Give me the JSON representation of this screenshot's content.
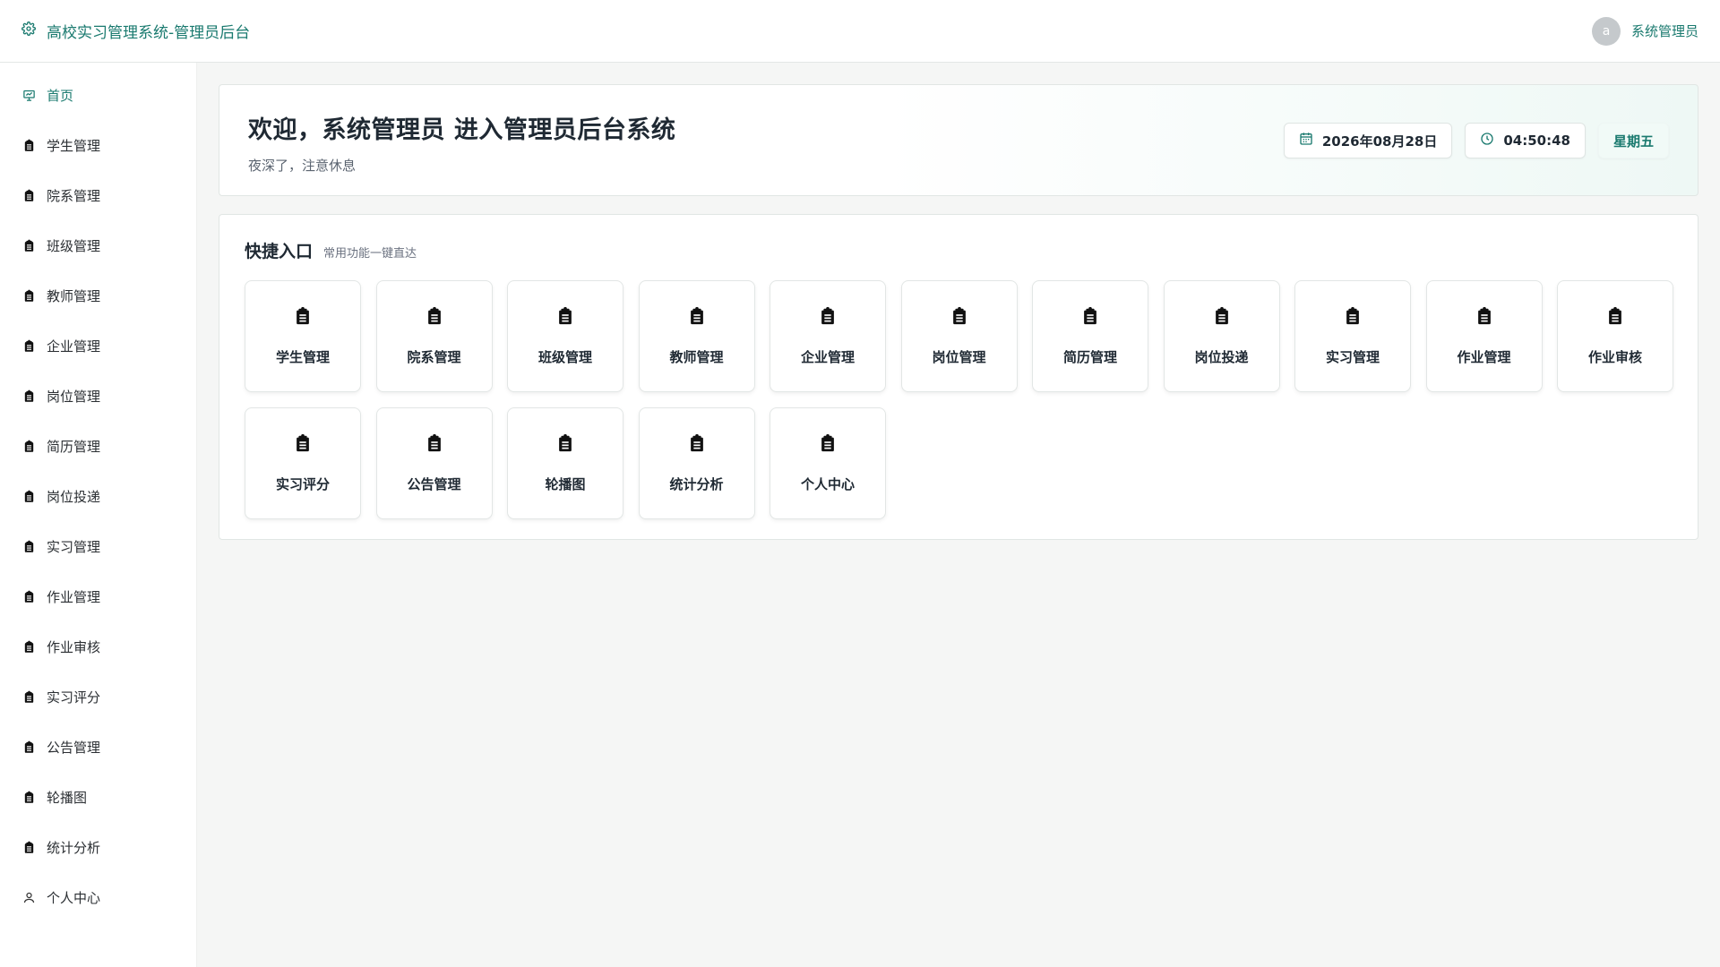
{
  "header": {
    "title": "高校实习管理系统-管理员后台",
    "user_initial": "a",
    "user_name": "系统管理员",
    "accent": "#1a7a6f"
  },
  "sidebar": {
    "items": [
      {
        "label": "首页",
        "icon": "presentation-icon",
        "active": true
      },
      {
        "label": "学生管理",
        "icon": "clipboard-icon"
      },
      {
        "label": "院系管理",
        "icon": "clipboard-icon"
      },
      {
        "label": "班级管理",
        "icon": "clipboard-icon"
      },
      {
        "label": "教师管理",
        "icon": "clipboard-icon"
      },
      {
        "label": "企业管理",
        "icon": "clipboard-icon"
      },
      {
        "label": "岗位管理",
        "icon": "clipboard-icon"
      },
      {
        "label": "简历管理",
        "icon": "clipboard-icon"
      },
      {
        "label": "岗位投递",
        "icon": "clipboard-icon"
      },
      {
        "label": "实习管理",
        "icon": "clipboard-icon"
      },
      {
        "label": "作业管理",
        "icon": "clipboard-icon"
      },
      {
        "label": "作业审核",
        "icon": "clipboard-icon"
      },
      {
        "label": "实习评分",
        "icon": "clipboard-icon"
      },
      {
        "label": "公告管理",
        "icon": "clipboard-icon"
      },
      {
        "label": "轮播图",
        "icon": "clipboard-icon"
      },
      {
        "label": "统计分析",
        "icon": "clipboard-icon"
      },
      {
        "label": "个人中心",
        "icon": "user-icon"
      }
    ]
  },
  "welcome": {
    "title": "欢迎，系统管理员 进入管理员后台系统",
    "subtitle": "夜深了，注意休息",
    "date": "2026年08月28日",
    "time": "04:50:48",
    "weekday": "星期五"
  },
  "quick": {
    "title": "快捷入口",
    "subtitle": "常用功能一键直达",
    "items": [
      {
        "label": "学生管理",
        "icon": "clipboard-icon"
      },
      {
        "label": "院系管理",
        "icon": "clipboard-icon"
      },
      {
        "label": "班级管理",
        "icon": "clipboard-icon"
      },
      {
        "label": "教师管理",
        "icon": "clipboard-icon"
      },
      {
        "label": "企业管理",
        "icon": "clipboard-icon"
      },
      {
        "label": "岗位管理",
        "icon": "clipboard-icon"
      },
      {
        "label": "简历管理",
        "icon": "clipboard-icon"
      },
      {
        "label": "岗位投递",
        "icon": "clipboard-icon"
      },
      {
        "label": "实习管理",
        "icon": "clipboard-icon"
      },
      {
        "label": "作业管理",
        "icon": "clipboard-icon"
      },
      {
        "label": "作业审核",
        "icon": "clipboard-icon"
      },
      {
        "label": "实习评分",
        "icon": "clipboard-icon"
      },
      {
        "label": "公告管理",
        "icon": "clipboard-icon"
      },
      {
        "label": "轮播图",
        "icon": "clipboard-icon"
      },
      {
        "label": "统计分析",
        "icon": "clipboard-icon"
      },
      {
        "label": "个人中心",
        "icon": "clipboard-icon"
      }
    ]
  }
}
